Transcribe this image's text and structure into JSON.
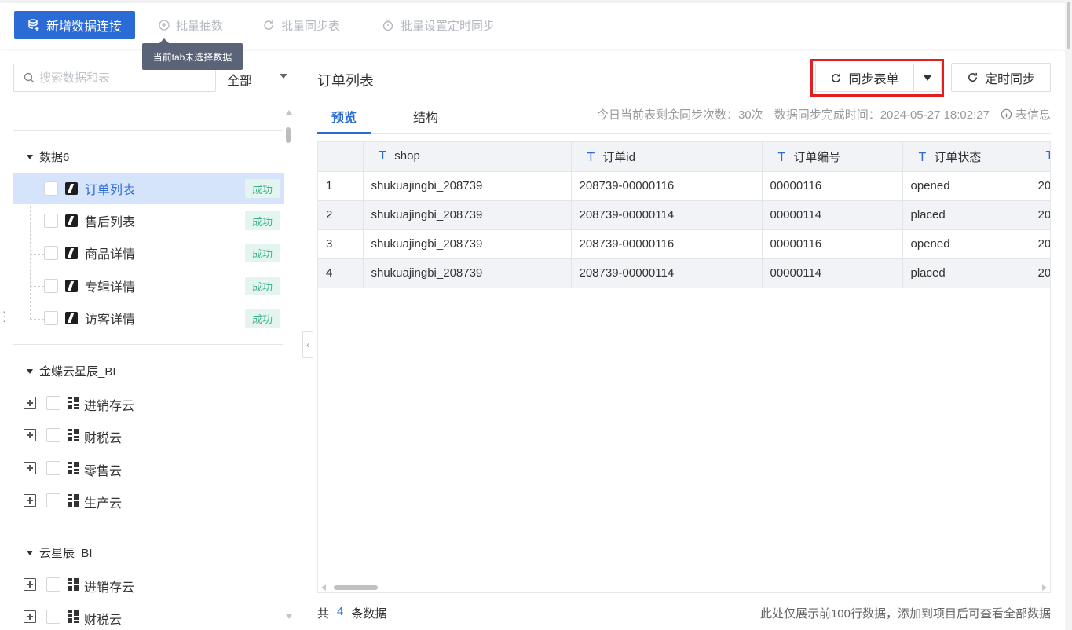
{
  "toolbar": {
    "add_connection": "新增数据连接",
    "batch_extract": "批量抽数",
    "batch_sync_table": "批量同步表",
    "batch_schedule": "批量设置定时同步",
    "tooltip": "当前tab未选择数据"
  },
  "sidebar": {
    "search_placeholder": "搜索数据和表",
    "filter_value": "全部",
    "group1": {
      "name": "数据6",
      "items": [
        {
          "label": "订单列表",
          "status": "成功"
        },
        {
          "label": "售后列表",
          "status": "成功"
        },
        {
          "label": "商品详情",
          "status": "成功"
        },
        {
          "label": "专辑详情",
          "status": "成功"
        },
        {
          "label": "访客详情",
          "status": "成功"
        }
      ]
    },
    "group2": {
      "name": "金蝶云星辰_BI",
      "items": [
        {
          "label": "进销存云"
        },
        {
          "label": "财税云"
        },
        {
          "label": "零售云"
        },
        {
          "label": "生产云"
        }
      ]
    },
    "group3": {
      "name": "云星辰_BI",
      "items": [
        {
          "label": "进销存云"
        },
        {
          "label": "财税云"
        }
      ]
    }
  },
  "main": {
    "title": "订单列表",
    "sync_button": "同步表单",
    "timer_button": "定时同步",
    "tabs": [
      "预览",
      "结构"
    ],
    "remaining_sync": "今日当前表剩余同步次数：30次",
    "sync_time": "数据同步完成时间：2024-05-27 18:02:27",
    "table_info": "表信息",
    "columns": [
      "shop",
      "订单id",
      "订单编号",
      "订单状态",
      ""
    ],
    "rows": [
      [
        "1",
        "shukuajingbi_208739",
        "208739-00000116",
        "00000116",
        "opened",
        "20"
      ],
      [
        "2",
        "shukuajingbi_208739",
        "208739-00000114",
        "00000114",
        "placed",
        "20"
      ],
      [
        "3",
        "shukuajingbi_208739",
        "208739-00000116",
        "00000116",
        "opened",
        "20"
      ],
      [
        "4",
        "shukuajingbi_208739",
        "208739-00000114",
        "00000114",
        "placed",
        "20"
      ]
    ],
    "footer_prefix": "共",
    "footer_count": "4",
    "footer_suffix": "条数据",
    "footer_note": "此处仅展示前100行数据，添加到项目后可查看全部数据"
  },
  "colors": {
    "primary": "#2a6bd6",
    "success_bg": "#e3f5ee",
    "success_text": "#3cb38a",
    "highlight_box": "#e02020"
  }
}
